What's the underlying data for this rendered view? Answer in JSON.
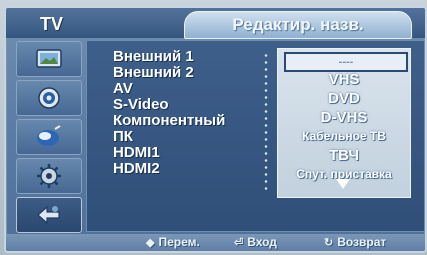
{
  "header": {
    "section_label": "TV",
    "title": "Редактир. назв."
  },
  "sidebar": {
    "items": [
      {
        "icon": "picture-icon"
      },
      {
        "icon": "sound-icon"
      },
      {
        "icon": "channel-icon"
      },
      {
        "icon": "setup-icon"
      },
      {
        "icon": "input-icon",
        "active": true
      }
    ]
  },
  "sources": [
    "Внешний 1",
    "Внешний 2",
    "AV",
    "S-Video",
    "Компонентный",
    "ПК",
    "HDMI1",
    "HDMI2"
  ],
  "name_options": {
    "selected": "----",
    "items": [
      "VHS",
      "DVD",
      "D-VHS",
      "Кабельное ТВ",
      "ТВЧ",
      "Спут. приставка"
    ]
  },
  "footer": {
    "move_label": "Перем.",
    "enter_label": "Вход",
    "return_label": "Возврат"
  },
  "colors": {
    "panel": "#4e6f98",
    "title_tab": "#cfe0ef",
    "list_bg": "#d9e3ec"
  }
}
